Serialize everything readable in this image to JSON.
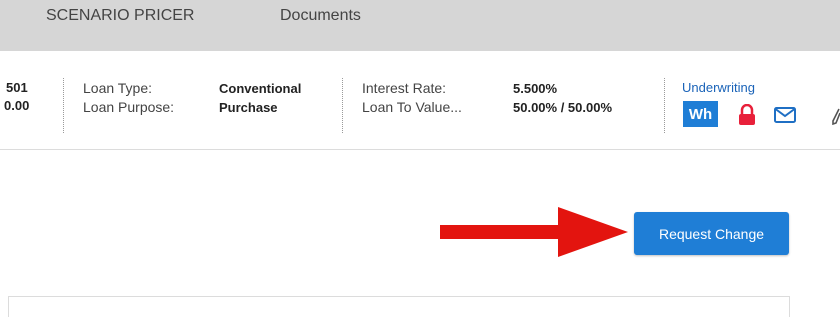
{
  "tabs": [
    "SCENARIO PRICER",
    "Documents"
  ],
  "summary": {
    "partial_top": "501",
    "partial_bottom": "0.00",
    "loan_type_label": "Loan Type:",
    "loan_type_value": "Conventional",
    "loan_purpose_label": "Loan Purpose:",
    "loan_purpose_value": "Purchase",
    "interest_rate_label": "Interest Rate:",
    "interest_rate_value": "5.500%",
    "ltv_label": "Loan To Value...",
    "ltv_value": "50.00% / 50.00%",
    "underwriting_link": "Underwriting",
    "wh_badge": "Wh"
  },
  "actions": {
    "request_change_label": "Request Change"
  },
  "icons": [
    "lock-icon",
    "mail-icon"
  ],
  "colors": {
    "accent_blue": "#1f7ed6",
    "link_blue": "#1a63b8",
    "lock_red": "#e8203a",
    "arrow_red": "#e3140f",
    "nav_gray": "#d6d6d6"
  }
}
